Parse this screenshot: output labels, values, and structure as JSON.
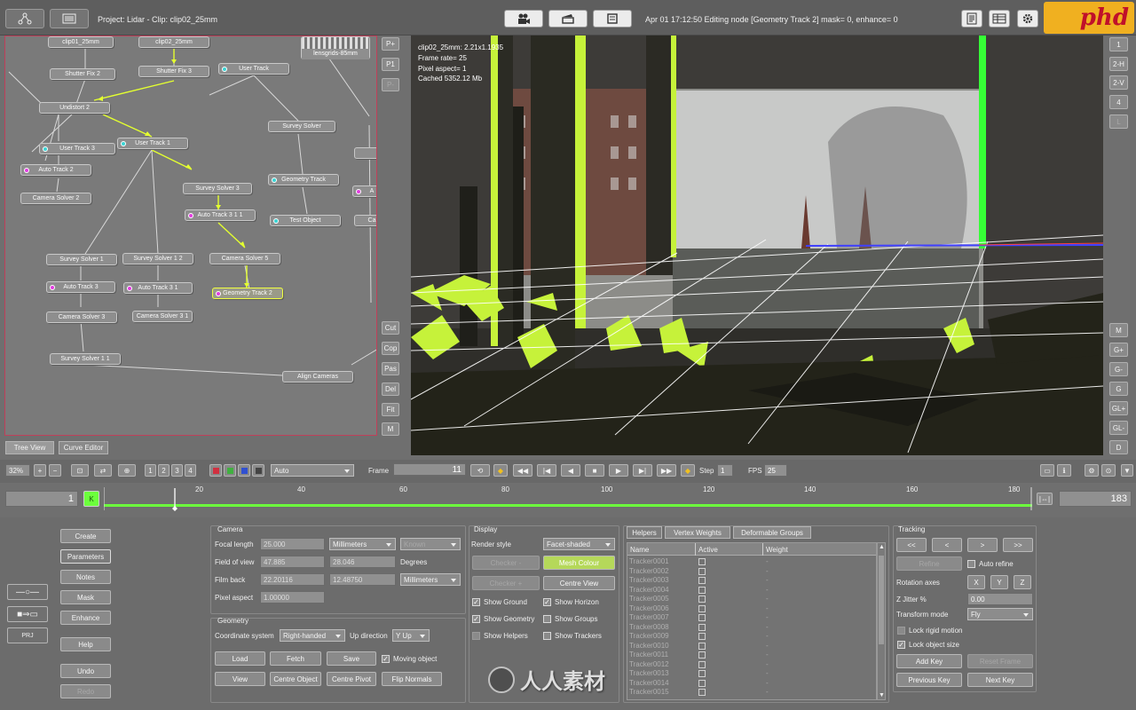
{
  "top": {
    "project_label": "Project: Lidar - Clip: clip02_25mm",
    "status": "Apr 01 17:12:50 Editing node [Geometry Track 2] mask= 0, enhance= 0",
    "logo": "phd"
  },
  "tree": {
    "nodes": [
      {
        "label": "clip01_25mm"
      },
      {
        "label": "clip02_25mm"
      },
      {
        "label": "lensgrids-85mm"
      },
      {
        "label": "Shutter Fix 2"
      },
      {
        "label": "Shutter Fix 3"
      },
      {
        "label": "User Track"
      },
      {
        "label": "Undistort 2"
      },
      {
        "label": "Survey Solver"
      },
      {
        "label": "User Track 3"
      },
      {
        "label": "User Track 1"
      },
      {
        "label": "Auto Track 2"
      },
      {
        "label": "Geometry Track"
      },
      {
        "label": "Survey Solver 3"
      },
      {
        "label": "Camera Solver 2"
      },
      {
        "label": "Auto Track 3 1 1"
      },
      {
        "label": "Test Object"
      },
      {
        "label": "Survey Solver 1"
      },
      {
        "label": "Survey Solver 1 2"
      },
      {
        "label": "Camera Solver 5"
      },
      {
        "label": "Auto Track 3"
      },
      {
        "label": "Auto Track 3 1"
      },
      {
        "label": "Geometry Track 2"
      },
      {
        "label": "Camera Solver 3"
      },
      {
        "label": "Camera Solver 3 1"
      },
      {
        "label": "Survey Solver 1 1"
      },
      {
        "label": "Align Cameras"
      },
      {
        "label": "A"
      },
      {
        "label": "Ca"
      }
    ]
  },
  "tree_side": [
    "P+",
    "P1",
    "P-",
    "Cut",
    "Cop",
    "Pas",
    "Del",
    "Fit",
    "M"
  ],
  "viewer_info": [
    "clip02_25mm: 2.21x1.1935",
    "Frame rate= 25",
    "Pixel aspect= 1",
    "Cached 5352.12 Mb"
  ],
  "right_col_top": [
    "1",
    "2-H",
    "2-V",
    "4",
    "L"
  ],
  "right_col_bottom": [
    "M",
    "G+",
    "G-",
    "G",
    "GL+",
    "GL-",
    "D"
  ],
  "tabs": [
    "Tree View",
    "Curve Editor"
  ],
  "playback": {
    "zoom": "32%",
    "views": [
      "1",
      "2",
      "3",
      "4"
    ],
    "mode": "Auto",
    "frame_label": "Frame",
    "frame": "11",
    "step_label": "Step",
    "step": "1",
    "fps_label": "FPS",
    "fps": "25"
  },
  "timeline": {
    "start": "1",
    "end": "183",
    "ticks": [
      "20",
      "40",
      "60",
      "80",
      "100",
      "120",
      "140",
      "160",
      "180"
    ],
    "green_tag": "K"
  },
  "left_menu": [
    "Create",
    "Parameters",
    "Notes",
    "Mask",
    "Enhance",
    "Help",
    "Undo",
    "Redo"
  ],
  "camera": {
    "title": "Camera",
    "focal_label": "Focal length",
    "focal": "25.000",
    "focal_unit": "Millimeters",
    "focal_state": "Known",
    "fov_label": "Field of view",
    "fov_x": "47.885",
    "fov_y": "28.046",
    "fov_unit": "Degrees",
    "filmback_label": "Film back",
    "fb_x": "22.20116",
    "fb_y": "12.48750",
    "fb_unit": "Millimeters",
    "aspect_label": "Pixel aspect",
    "aspect": "1.00000"
  },
  "geometry": {
    "title": "Geometry",
    "coord_label": "Coordinate system",
    "coord": "Right-handed",
    "up_label": "Up direction",
    "up": "Y Up",
    "buttons": [
      "Load",
      "Fetch",
      "Save",
      "View",
      "Centre Object",
      "Centre Pivot",
      "Flip Normals"
    ],
    "moving_label": "Moving object"
  },
  "display": {
    "title": "Display",
    "render_label": "Render style",
    "render": "Facet-shaded",
    "btns": [
      "Checker -",
      "Mesh Colour",
      "Checker +",
      "Centre View"
    ],
    "checks": [
      "Show Ground",
      "Show Horizon",
      "Show Geometry",
      "Show Groups",
      "Show Helpers",
      "Show Trackers"
    ]
  },
  "helpers": {
    "tabs": [
      "Helpers",
      "Vertex Weights",
      "Deformable Groups"
    ],
    "cols": [
      "Name",
      "Active",
      "Weight"
    ],
    "rows": [
      "Tracker0001",
      "Tracker0002",
      "Tracker0003",
      "Tracker0004",
      "Tracker0005",
      "Tracker0006",
      "Tracker0007",
      "Tracker0008",
      "Tracker0009",
      "Tracker0010",
      "Tracker0011",
      "Tracker0012",
      "Tracker0013",
      "Tracker0014",
      "Tracker0015"
    ],
    "weight_dash": "-"
  },
  "tracking": {
    "title": "Tracking",
    "nav": [
      "<<",
      "<",
      ">",
      ">>"
    ],
    "refine": "Refine",
    "auto_refine": "Auto refine",
    "rot_label": "Rotation axes",
    "axes": [
      "X",
      "Y",
      "Z"
    ],
    "jitter_label": "Z Jitter %",
    "jitter": "0.00",
    "transform_label": "Transform mode",
    "transform": "Fly",
    "lock_rigid": "Lock rigid motion",
    "lock_size": "Lock object size",
    "add_key": "Add Key",
    "reset_frame": "Reset Frame",
    "prev_key": "Previous Key",
    "next_key": "Next Key"
  },
  "watermark": "人人素材",
  "colors": {
    "accent_green": "#c6f23a",
    "timeline_green": "#6cff3c",
    "select_red": "#c0405a"
  }
}
